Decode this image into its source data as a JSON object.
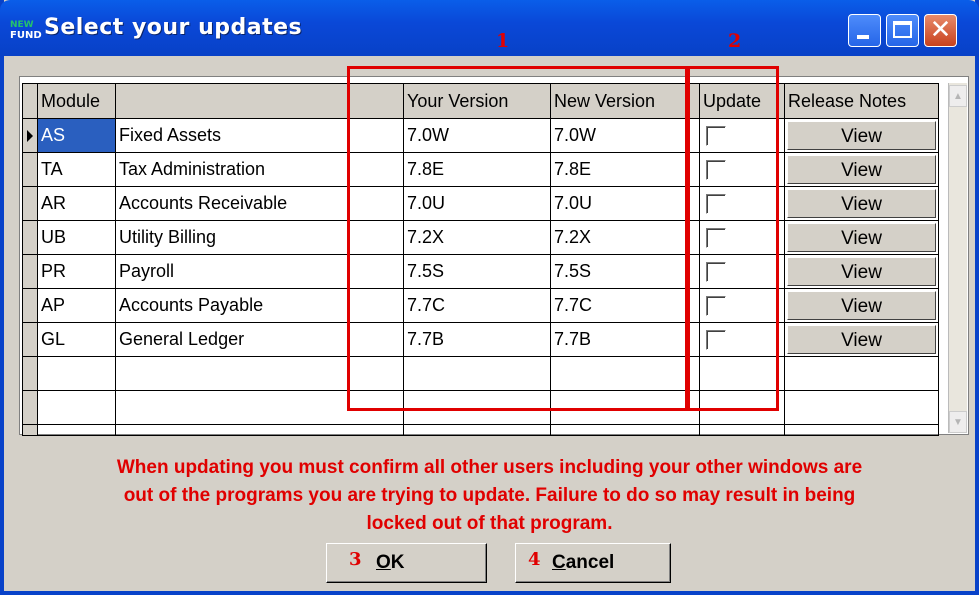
{
  "window": {
    "title": "Select your updates",
    "logo": {
      "line1": "NEW",
      "line2": "FUND"
    }
  },
  "annotations": {
    "n1": "1",
    "n2": "2",
    "n3": "3",
    "n4": "4"
  },
  "grid": {
    "headers": {
      "module": "Module",
      "name": "",
      "your_version": "Your Version",
      "new_version": "New Version",
      "update": "Update",
      "release_notes": "Release Notes"
    },
    "rows": [
      {
        "code": "AS",
        "name": "Fixed Assets",
        "your_version": "7.0W",
        "new_version": "7.0W",
        "update": false,
        "notes": "View",
        "selected": true
      },
      {
        "code": "TA",
        "name": "Tax Administration",
        "your_version": "7.8E",
        "new_version": "7.8E",
        "update": false,
        "notes": "View"
      },
      {
        "code": "AR",
        "name": "Accounts Receivable",
        "your_version": "7.0U",
        "new_version": "7.0U",
        "update": false,
        "notes": "View"
      },
      {
        "code": "UB",
        "name": "Utility Billing",
        "your_version": "7.2X",
        "new_version": "7.2X",
        "update": false,
        "notes": "View"
      },
      {
        "code": "PR",
        "name": "Payroll",
        "your_version": "7.5S",
        "new_version": "7.5S",
        "update": false,
        "notes": "View"
      },
      {
        "code": "AP",
        "name": "Accounts Payable",
        "your_version": "7.7C",
        "new_version": "7.7C",
        "update": false,
        "notes": "View"
      },
      {
        "code": "GL",
        "name": "General Ledger",
        "your_version": "7.7B",
        "new_version": "7.7B",
        "update": false,
        "notes": "View"
      }
    ]
  },
  "warning": {
    "line1": "When updating you must confirm all other users including your other windows are",
    "line2": "out of the programs you are trying to update.  Failure to do so may result in being",
    "line3": "locked out of that program."
  },
  "buttons": {
    "ok": {
      "number": "3",
      "mnemonic": "O",
      "rest": "K"
    },
    "cancel": {
      "number": "4",
      "mnemonic": "C",
      "rest": "ancel"
    }
  },
  "colors": {
    "titlebar": "#0a48d8",
    "annotation": "#e00000",
    "selection": "#2a5fbf"
  }
}
